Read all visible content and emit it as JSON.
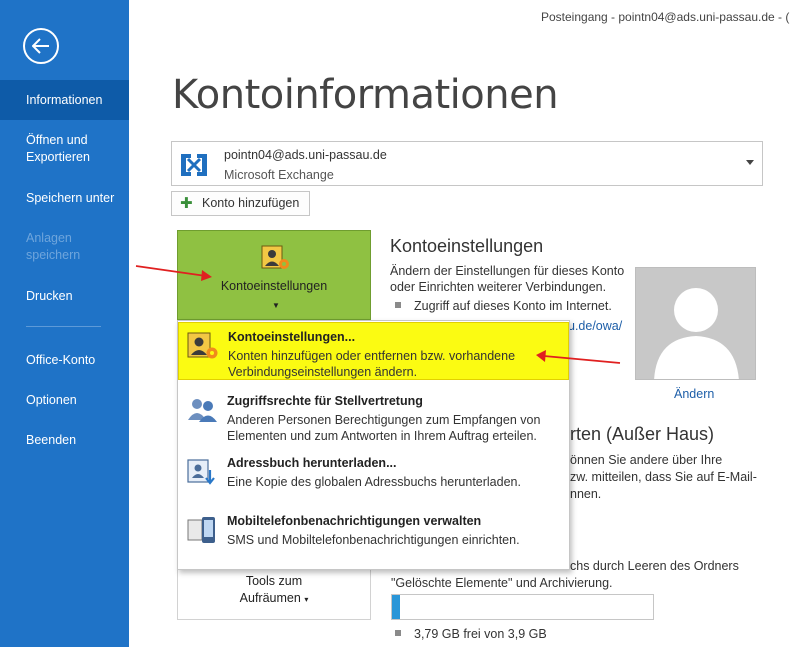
{
  "window": {
    "title": "Posteingang - pointn04@ads.uni-passau.de - ("
  },
  "sidebar": {
    "items": [
      {
        "label": "Informationen",
        "state": "active"
      },
      {
        "label": "Öffnen und Exportieren",
        "state": "normal"
      },
      {
        "label": "Speichern unter",
        "state": "normal"
      },
      {
        "label": "Anlagen speichern",
        "state": "disabled"
      },
      {
        "label": "Drucken",
        "state": "normal"
      },
      {
        "label": "Office-Konto",
        "state": "normal"
      },
      {
        "label": "Optionen",
        "state": "normal"
      },
      {
        "label": "Beenden",
        "state": "normal"
      }
    ],
    "item_lines": {
      "open_export_1": "Öffnen und",
      "open_export_2": "Exportieren",
      "attachments_1": "Anlagen",
      "attachments_2": "speichern"
    }
  },
  "page": {
    "title": "Kontoinformationen"
  },
  "account": {
    "email": "pointn04@ads.uni-passau.de",
    "type": "Microsoft Exchange",
    "add_button": "Konto hinzufügen"
  },
  "account_settings": {
    "button_label": "Kontoeinstellungen",
    "heading": "Kontoeinstellungen",
    "desc_line1": "Ändern der Einstellungen für dieses Konto",
    "desc_line2": "oder Einrichten weiterer Verbindungen.",
    "bullet": "Zugriff auf dieses Konto im Internet.",
    "link_fragment": "u.de/owa/"
  },
  "profile": {
    "change_link": "Ändern"
  },
  "dropdown": {
    "items": [
      {
        "title": "Kontoeinstellungen...",
        "desc1": "Konten hinzufügen oder entfernen bzw. vorhandene",
        "desc2": "Verbindungseinstellungen ändern.",
        "icon": "account-settings-icon"
      },
      {
        "title": "Zugriffsrechte für Stellvertretung",
        "desc1": "Anderen Personen Berechtigungen zum Empfangen von",
        "desc2": "Elementen und zum Antworten in Ihrem Auftrag erteilen.",
        "icon": "delegate-access-icon"
      },
      {
        "title": "Adressbuch herunterladen...",
        "desc1": "Eine Kopie des globalen Adressbuchs herunterladen.",
        "desc2": "",
        "icon": "address-book-download-icon"
      },
      {
        "title": "Mobiltelefonbenachrichtigungen verwalten",
        "desc1": "SMS und Mobiltelefonbenachrichtigungen einrichten.",
        "desc2": "",
        "icon": "mobile-notifications-icon"
      }
    ]
  },
  "auto_reply": {
    "heading_fragment": "rten (Außer Haus)",
    "line1": "önnen Sie andere über Ihre",
    "line2": "zw. mitteilen, dass Sie auf E-Mail-",
    "line3": "nnen."
  },
  "cleanup": {
    "tools_label1": "Tools zum",
    "tools_label2": "Aufräumen",
    "line1": "chs durch Leeren des Ordners",
    "line2": "\"Gelöschte Elemente\" und Archivierung.",
    "storage_text": "3,79 GB frei von 3,9 GB",
    "storage_used_fraction": 0.03
  },
  "colors": {
    "sidebar": "#1f73c7",
    "sidebar_active": "#0e5ba8",
    "highlight": "#fbfb12",
    "button_green": "#8fc142",
    "link": "#1d5ea8",
    "annotation_arrow": "#e02020"
  }
}
